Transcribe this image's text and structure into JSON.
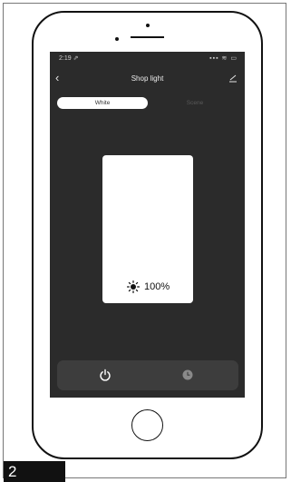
{
  "status_bar": {
    "time": "2:19 ⇗",
    "icons": "▪▪▪ ≋ ▭"
  },
  "nav": {
    "back_glyph": "‹",
    "title": "Shop light"
  },
  "tabs": {
    "white_label": "White",
    "scene_label": "Scene"
  },
  "brightness": {
    "value": "100%"
  },
  "step": {
    "number": "2"
  },
  "icons": {
    "back": "chevron-left-icon",
    "edit": "pencil-icon",
    "sun": "sun-icon",
    "power": "power-icon",
    "timer": "clock-icon"
  },
  "colors": {
    "screen_bg": "#2b2b2b",
    "bar_bg": "#3d3d3d",
    "panel_bg": "#ffffff"
  }
}
